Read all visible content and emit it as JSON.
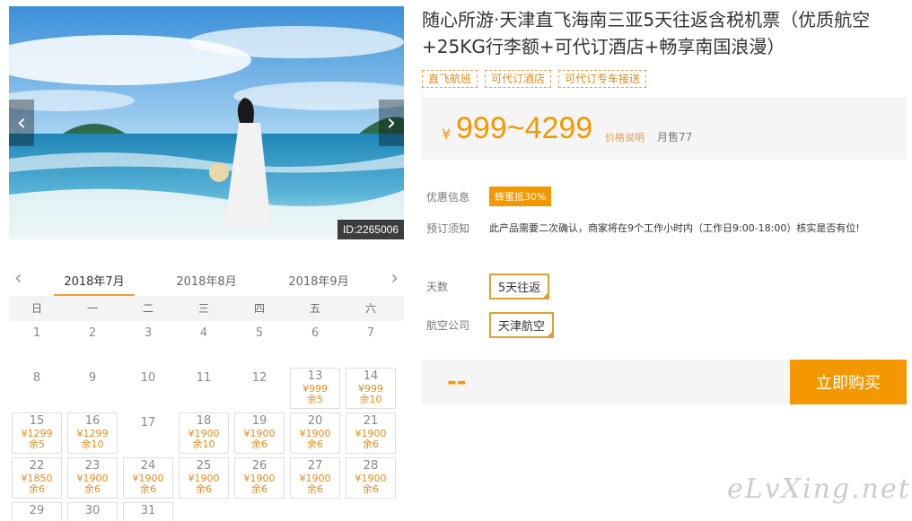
{
  "hero": {
    "image_id": "ID:2265006",
    "prev_icon": "chevron-left-icon",
    "next_icon": "chevron-right-icon"
  },
  "product": {
    "title": "随心所游·天津直飞海南三亚5天往返含税机票（优质航空+25KG行李额+可代订酒店+畅享南国浪漫）",
    "tags": [
      "直飞航班",
      "可代订酒店",
      "可代订专车接送"
    ],
    "price_symbol": "¥",
    "price_range": "999~4299",
    "price_note": "价格说明",
    "sold": "月售77",
    "discount_label": "优惠信息",
    "discount_badge": "蜂蜜抵30%",
    "notice_label": "预订须知",
    "notice_text": "此产品需要二次确认，商家将在9个工作小时内（工作日9:00-18:00）核实是否有位!",
    "days_label": "天数",
    "days_value": "5天往返",
    "airline_label": "航空公司",
    "airline_value": "天津航空",
    "buy_placeholder": "--",
    "buy_button": "立即购买"
  },
  "calendar": {
    "tabs": [
      "2018年7月",
      "2018年8月",
      "2018年9月"
    ],
    "weekdays": [
      "日",
      "一",
      "二",
      "三",
      "四",
      "五",
      "六"
    ],
    "days": [
      {
        "d": "1"
      },
      {
        "d": "2"
      },
      {
        "d": "3"
      },
      {
        "d": "4"
      },
      {
        "d": "5"
      },
      {
        "d": "6"
      },
      {
        "d": "7"
      },
      {
        "d": "8"
      },
      {
        "d": "9"
      },
      {
        "d": "10"
      },
      {
        "d": "11"
      },
      {
        "d": "12"
      },
      {
        "d": "13",
        "p": "¥999",
        "s": "余5"
      },
      {
        "d": "14",
        "p": "¥999",
        "s": "余10"
      },
      {
        "d": "15",
        "p": "¥1299",
        "s": "余5"
      },
      {
        "d": "16",
        "p": "¥1299",
        "s": "余10"
      },
      {
        "d": "17"
      },
      {
        "d": "18",
        "p": "¥1900",
        "s": "余10"
      },
      {
        "d": "19",
        "p": "¥1900",
        "s": "余6"
      },
      {
        "d": "20",
        "p": "¥1900",
        "s": "余6"
      },
      {
        "d": "21",
        "p": "¥1900",
        "s": "余6"
      },
      {
        "d": "22",
        "p": "¥1850",
        "s": "余6"
      },
      {
        "d": "23",
        "p": "¥1900",
        "s": "余6"
      },
      {
        "d": "24",
        "p": "¥1900",
        "s": "余6"
      },
      {
        "d": "25",
        "p": "¥1900",
        "s": "余6"
      },
      {
        "d": "26",
        "p": "¥1900",
        "s": "余6"
      },
      {
        "d": "27",
        "p": "¥1900",
        "s": "余6"
      },
      {
        "d": "28",
        "p": "¥1900",
        "s": "余6"
      },
      {
        "d": "29",
        "p": "",
        "s": ""
      },
      {
        "d": "30",
        "p": "",
        "s": ""
      },
      {
        "d": "31",
        "p": "",
        "s": ""
      }
    ]
  },
  "watermark": "eLvXing.net",
  "colors": {
    "accent": "#f39800",
    "price_text": "#e08a1a"
  }
}
